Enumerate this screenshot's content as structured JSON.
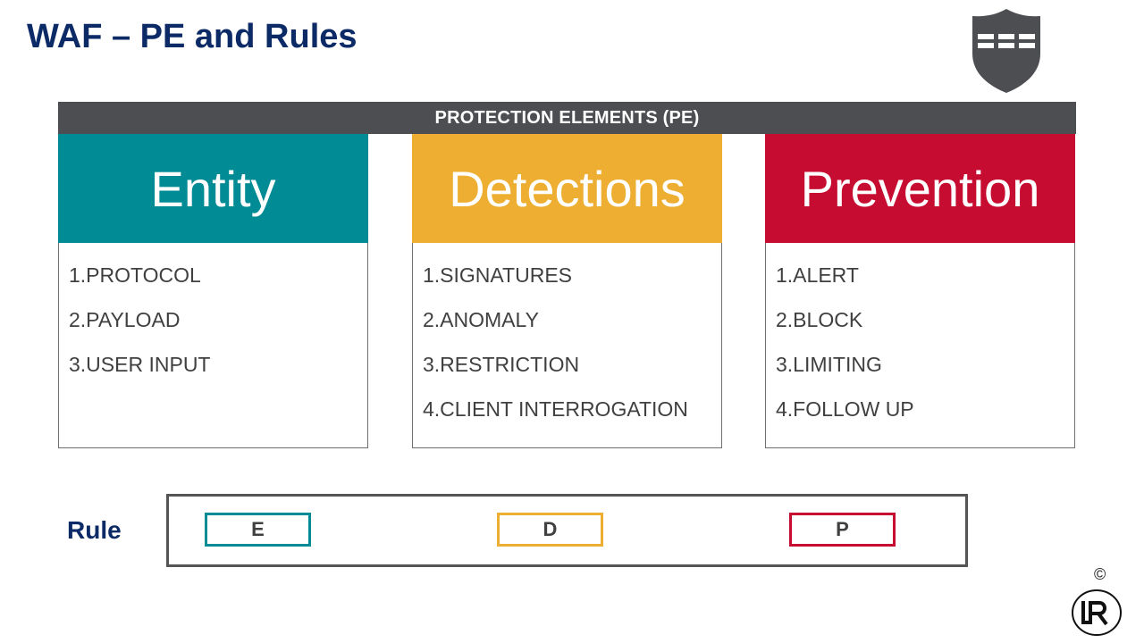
{
  "title": "WAF – PE and Rules",
  "pe_header": "PROTECTION ELEMENTS (PE)",
  "columns": [
    {
      "heading": "Entity",
      "color": "#008b95",
      "items": [
        "1.PROTOCOL",
        "2.PAYLOAD",
        "3.USER INPUT"
      ]
    },
    {
      "heading": "Detections",
      "color": "#edae31",
      "items": [
        "1.SIGNATURES",
        "2.ANOMALY",
        "3.RESTRICTION",
        "4.CLIENT INTERROGATION"
      ]
    },
    {
      "heading": "Prevention",
      "color": "#c60c30",
      "items": [
        "1.ALERT",
        "2.BLOCK",
        "3.LIMITING",
        "4.FOLLOW UP"
      ]
    }
  ],
  "rule": {
    "label": "Rule",
    "cells": [
      {
        "letter": "E",
        "color": "#008b95"
      },
      {
        "letter": "D",
        "color": "#edae31"
      },
      {
        "letter": "P",
        "color": "#c60c30"
      }
    ]
  },
  "copyright_symbol": "©",
  "icons": {
    "shield": "shield-icon",
    "logo": "lr-logo"
  }
}
